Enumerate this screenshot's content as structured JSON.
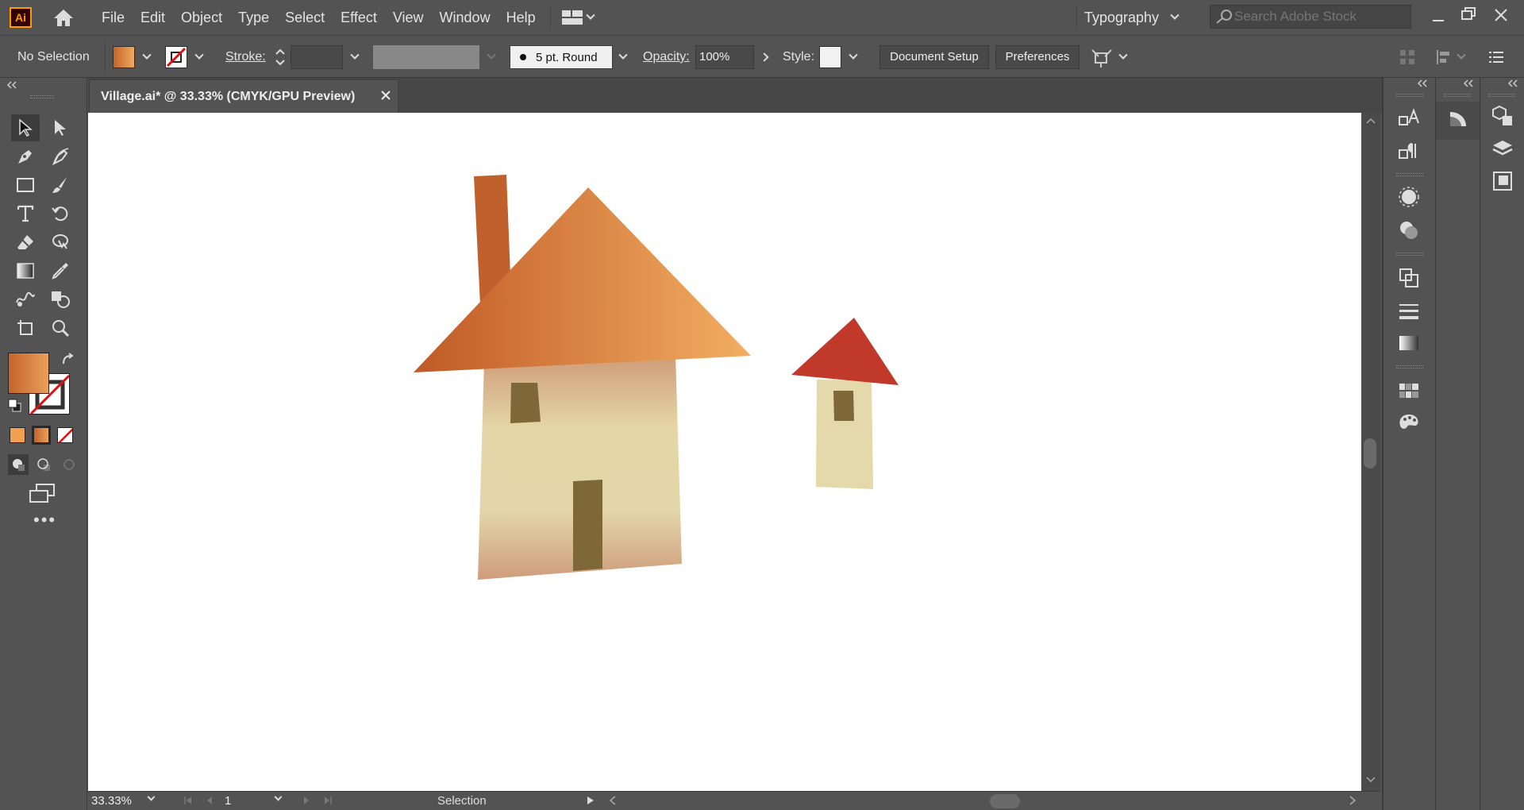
{
  "app": {
    "logo_text": "Ai"
  },
  "menu": {
    "items": [
      "File",
      "Edit",
      "Object",
      "Type",
      "Select",
      "Effect",
      "View",
      "Window",
      "Help"
    ],
    "workspace": "Typography",
    "search_placeholder": "Search Adobe Stock"
  },
  "control": {
    "selection_label": "No Selection",
    "stroke_label": "Stroke:",
    "brush_label": "5 pt. Round",
    "opacity_label": "Opacity:",
    "opacity_value": "100%",
    "style_label": "Style:",
    "document_setup": "Document Setup",
    "preferences": "Preferences"
  },
  "document": {
    "tab_title": "Village.ai* @ 33.33% (CMYK/GPU Preview)"
  },
  "status": {
    "zoom": "33.33%",
    "artboard": "1",
    "tool": "Selection"
  },
  "colors": {
    "fill_gradient_start": "#c4642c",
    "fill_gradient_end": "#f0aa5e",
    "small_roof": "#c0392b",
    "wall": "#e4d9aa",
    "window": "#7f6838",
    "canvas": "#ffffff",
    "ui_bg": "#535353"
  }
}
